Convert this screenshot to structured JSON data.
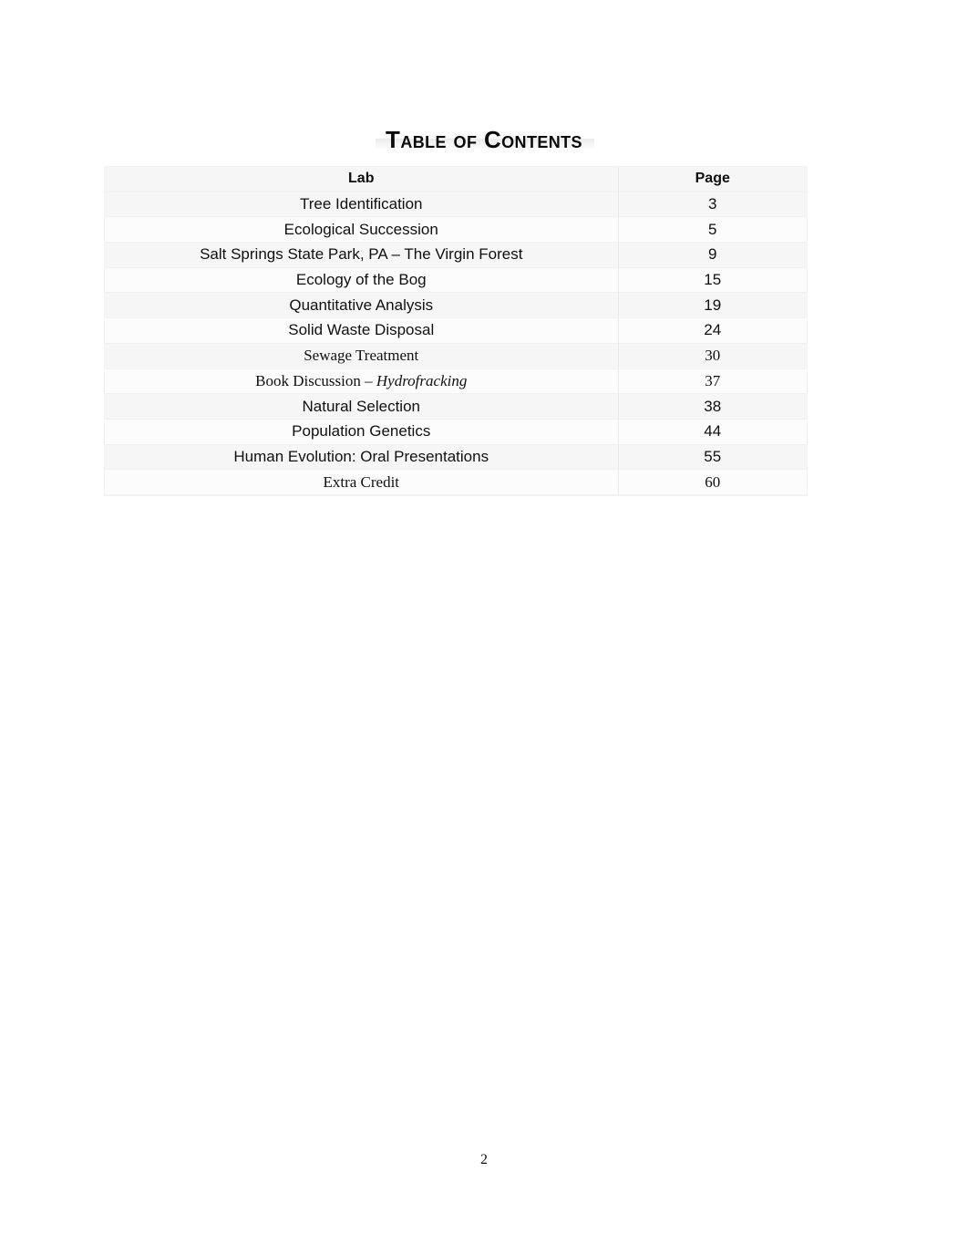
{
  "document": {
    "title": "Table of Contents",
    "page_number": "2"
  },
  "table": {
    "headers": {
      "lab": "Lab",
      "page": "Page"
    },
    "rows": [
      {
        "lab": "Tree Identification",
        "page": "3",
        "font": "sans"
      },
      {
        "lab": "Ecological Succession",
        "page": "5",
        "font": "sans"
      },
      {
        "lab": "Salt Springs State Park, PA – The Virgin Forest",
        "page": "9",
        "font": "sans"
      },
      {
        "lab": "Ecology of the Bog",
        "page": "15",
        "font": "sans"
      },
      {
        "lab": "Quantitative Analysis",
        "page": "19",
        "font": "sans"
      },
      {
        "lab": "Solid Waste Disposal",
        "page": "24",
        "font": "sans"
      },
      {
        "lab": "Sewage Treatment",
        "page": "30",
        "font": "serif"
      },
      {
        "lab": "Book Discussion – ",
        "lab_italic": "Hydrofracking",
        "page": "37",
        "font": "serif"
      },
      {
        "lab": "Natural Selection",
        "page": "38",
        "font": "sans"
      },
      {
        "lab": "Population Genetics",
        "page": "44",
        "font": "sans"
      },
      {
        "lab": "Human Evolution: Oral Presentations",
        "page": "55",
        "font": "sans"
      },
      {
        "lab": "Extra Credit",
        "page": "60",
        "font": "serif"
      }
    ]
  },
  "colors": {
    "page_background": "#ffffff",
    "text": "#101010",
    "table_band_light": "#fcfcfd",
    "table_band_dark": "#f6f6f7",
    "rule": "#ececee"
  }
}
